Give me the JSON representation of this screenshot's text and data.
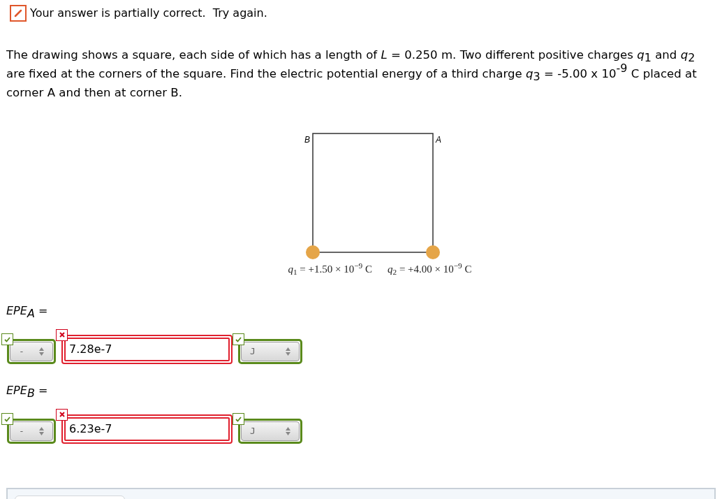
{
  "feedback": {
    "partial": true,
    "text": "Your answer is partially correct.  Try again."
  },
  "question": "The drawing shows a square, each side of which has a length of *L* = 0.250 m. Two different positive charges *q*$_{1}$ and *q*$_{2}$ are fixed at the corners of the square. Find the electric potential energy of a third charge *q*$_{3}$ = -5.00 x 10$^{-9}$ C placed at corner A and then at corner B.",
  "figure": {
    "corner_top_left": "B",
    "corner_top_right": "A",
    "charges": [
      "*q*$_{1}$ = +1.50 × 10$^{−9}$ C",
      "*q*$_{2}$ = +4.00 × 10$^{−9}$ C"
    ]
  },
  "answers": [
    {
      "label": "EPE$_{A}$ =",
      "sign": {
        "value": "-",
        "correct": true
      },
      "value": {
        "value": "7.28e-7",
        "correct": false
      },
      "unit": {
        "value": "J",
        "correct": true
      }
    },
    {
      "label": "EPE$_{B}$ =",
      "sign": {
        "value": "-",
        "correct": true
      },
      "value": {
        "value": "6.23e-7",
        "correct": false
      },
      "unit": {
        "value": "J",
        "correct": true
      }
    }
  ]
}
